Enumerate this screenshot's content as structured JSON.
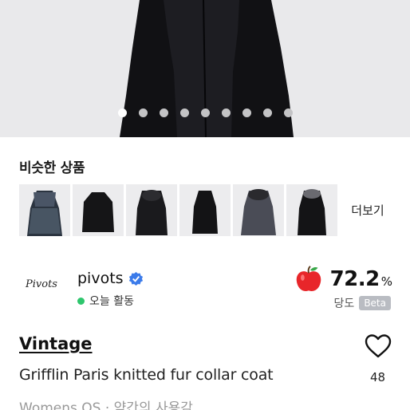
{
  "gallery": {
    "page_count": 9,
    "active_index": 0
  },
  "similar": {
    "title": "비슷한 상품",
    "more_label": "더보기",
    "items": [
      {
        "icon": "fur-coat-thumb-1"
      },
      {
        "icon": "black-coat-thumb-2"
      },
      {
        "icon": "leather-coat-thumb-3"
      },
      {
        "icon": "black-coat-thumb-4"
      },
      {
        "icon": "grey-coat-thumb-5"
      },
      {
        "icon": "black-coat-thumb-6"
      }
    ]
  },
  "seller": {
    "logo_text": "Pivots",
    "name": "pivots",
    "activity": "오늘 활동",
    "activity_color": "#2ec66d"
  },
  "score": {
    "value": "72.2",
    "unit": "%",
    "label": "당도",
    "badge": "Beta"
  },
  "product": {
    "brand": "Vintage",
    "title": "Grifflin Paris knitted fur collar coat",
    "subinfo": "Womens OS · 약간의 사용감",
    "likes": "48"
  }
}
